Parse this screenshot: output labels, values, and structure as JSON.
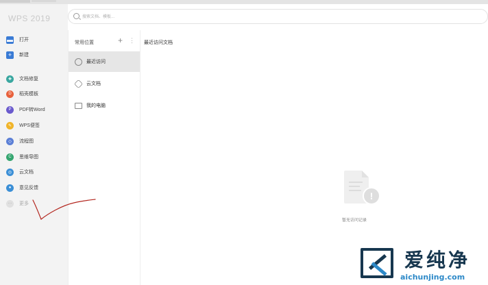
{
  "app": {
    "brand": "WPS 2019"
  },
  "search": {
    "placeholder": "搜索文档、模板..."
  },
  "sidebar": {
    "items": [
      {
        "label": "打开",
        "icon": "folder-icon",
        "color": "#3a7bd5"
      },
      {
        "label": "新建",
        "icon": "plus-icon",
        "color": "#3a7bd5"
      },
      {
        "label": "文档修复",
        "icon": "repair-icon",
        "color": "#3aa7a0"
      },
      {
        "label": "稻壳模板",
        "icon": "template-icon",
        "color": "#e8613c"
      },
      {
        "label": "PDF转Word",
        "icon": "pdf-icon",
        "color": "#6a5acd"
      },
      {
        "label": "WPS便签",
        "icon": "note-icon",
        "color": "#f0b429"
      },
      {
        "label": "流程图",
        "icon": "flowchart-icon",
        "color": "#5b7fd6"
      },
      {
        "label": "思维导图",
        "icon": "mindmap-icon",
        "color": "#34a56f"
      },
      {
        "label": "云文档",
        "icon": "cloud-doc-icon",
        "color": "#3b8fd6"
      },
      {
        "label": "意见反馈",
        "icon": "feedback-icon",
        "color": "#3b8fd6"
      },
      {
        "label": "更多",
        "icon": "more-icon",
        "color": "#cccccc"
      }
    ]
  },
  "locations": {
    "header": "常用位置",
    "items": [
      {
        "label": "最近访问",
        "icon": "clock-icon"
      },
      {
        "label": "云文档",
        "icon": "cube-icon"
      },
      {
        "label": "我的电脑",
        "icon": "monitor-icon"
      }
    ]
  },
  "main": {
    "title": "最近访问文档",
    "empty_text": "暂无访问记录"
  },
  "watermark": {
    "text_cn": "爱纯净",
    "url": "aichunjing.com"
  }
}
